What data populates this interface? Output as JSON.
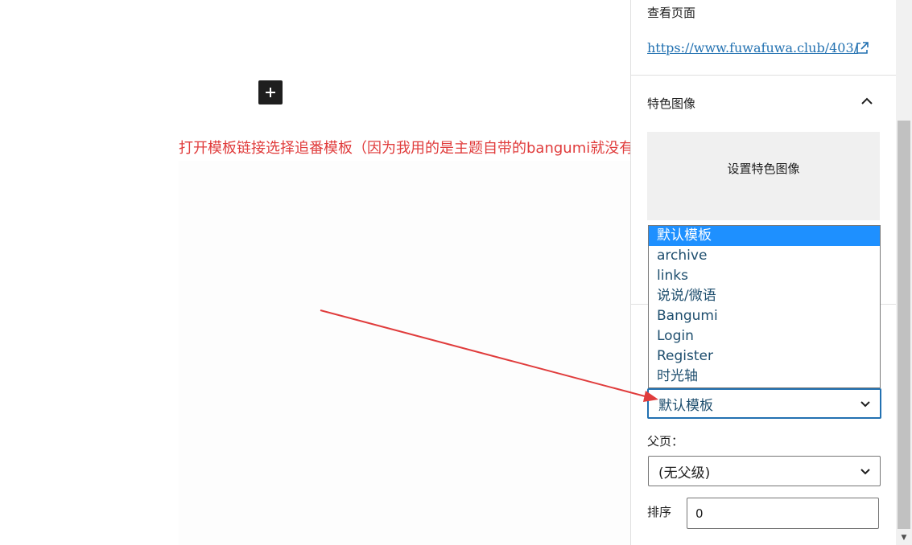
{
  "annotation": "打开模板链接选择追番模板（因为我用的是主题自带的bangumi就没有再弄）",
  "sidebar": {
    "view_page_label": "查看页面",
    "view_page_url": "https://www.fuwafuwa.club/403/",
    "featured_image_title": "特色图像",
    "set_featured_image": "设置特色图像",
    "template_options": [
      "默认模板",
      "archive",
      "links",
      "说说/微语",
      "Bangumi",
      "Login",
      "Register",
      "时光轴"
    ],
    "template_selected": "默认模板",
    "parent_label": "父页：",
    "parent_selected": "(无父级)",
    "order_label": "排序",
    "order_value": "0"
  },
  "colors": {
    "accent": "#2271b1",
    "dropdown_highlight": "#1e90ff",
    "annotation": "#e03c3c"
  }
}
